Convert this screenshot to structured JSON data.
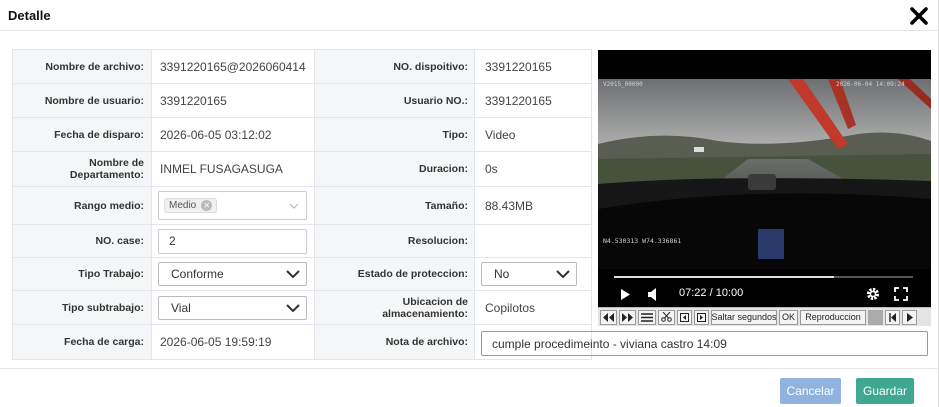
{
  "dialog": {
    "title": "Detalle",
    "close_icon": "close-icon"
  },
  "form": {
    "rows": [
      {
        "label": "Nombre de archivo:",
        "value": "3391220165@2026060414",
        "label2": "NO. dispoitivo:",
        "value2": "3391220165"
      },
      {
        "label": "Nombre de usuario:",
        "value": "3391220165",
        "label2": "Usuario NO.:",
        "value2": "3391220165"
      },
      {
        "label": "Fecha de disparo:",
        "value": "2026-06-05 03:12:02",
        "label2": "Tipo:",
        "value2": "Video"
      },
      {
        "label": "Nombre de Departamento:",
        "value": "INMEL FUSAGASUGA",
        "label2": "Duracion:",
        "value2": "0s"
      },
      {
        "label": "Rango medio:",
        "tag": "Medio",
        "label2": "Tamaño:",
        "value2": "88.43MB"
      },
      {
        "label": "NO. case:",
        "input_value": "2",
        "label2": "Resolucion:",
        "value2": ""
      },
      {
        "label": "Tipo Trabajo:",
        "select_value": "Conforme",
        "label2": "Estado de proteccion:",
        "select2_value": "No"
      },
      {
        "label": "Tipo subtrabajo:",
        "select_value": "Vial",
        "label2": "Ubicacion de almacenamiento:",
        "value2": "Copilotos"
      },
      {
        "label": "Fecha de carga:",
        "value": "2026-06-05 19:59:19",
        "label2": "Nota de archivo:"
      }
    ],
    "nota_value": "cumple procedimeinto - viviana castro 14:09"
  },
  "player": {
    "osd_top_left": "V2015_00000",
    "osd_top_right": "2026-06-04 14:09:24",
    "osd_gps": "N4.530313  W74.336861",
    "time_display": "07:22 / 10:00",
    "progress": 0.737,
    "toolbar": {
      "saltar_label": "Saltar segundos",
      "ok_label": "OK",
      "reproduccion_label": "Reproduccion"
    }
  },
  "footer": {
    "cancel_label": "Cancelar",
    "save_label": "Guardar"
  },
  "colors": {
    "cancel_bg": "#8fb3dd",
    "save_bg": "#3ea891",
    "label_bg": "#f5f6f7"
  }
}
